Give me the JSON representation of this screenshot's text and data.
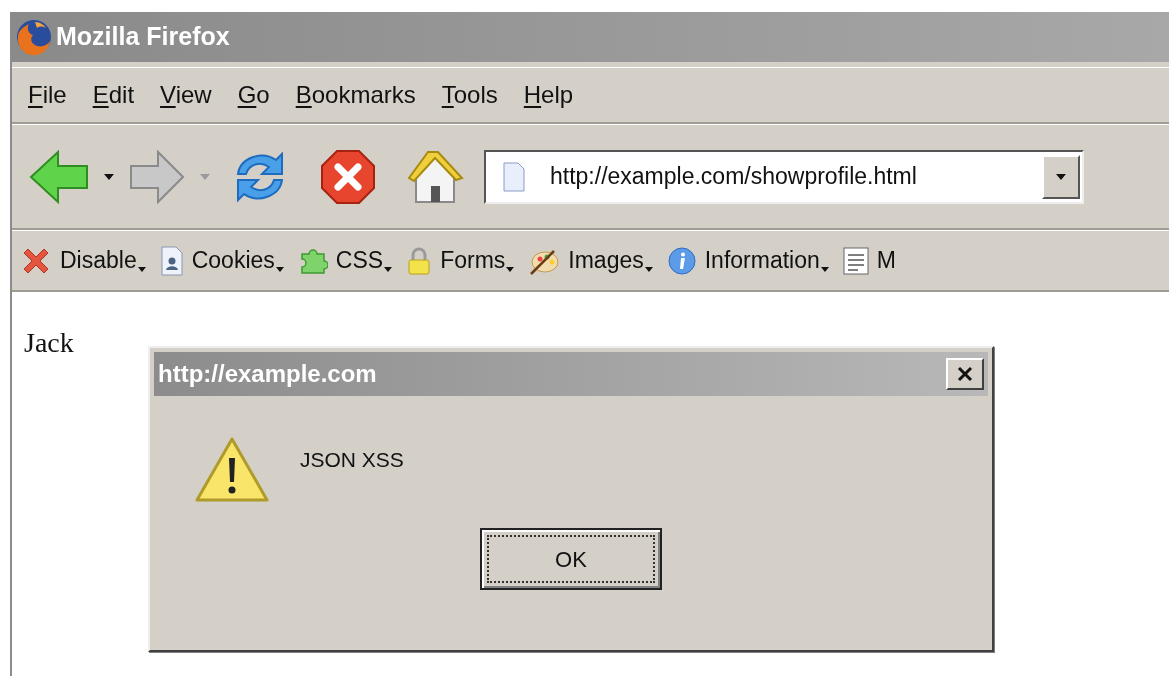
{
  "window": {
    "title": "Mozilla Firefox"
  },
  "menu": [
    {
      "label": "File",
      "access_key_underlined": true
    },
    {
      "label": "Edit",
      "access_key_underlined": true
    },
    {
      "label": "View",
      "access_key_underlined": true
    },
    {
      "label": "Go",
      "access_key_underlined": true
    },
    {
      "label": "Bookmarks",
      "access_key_underlined": true
    },
    {
      "label": "Tools",
      "access_key_underlined": true
    },
    {
      "label": "Help",
      "access_key_underlined": true
    }
  ],
  "navigation": {
    "back": {
      "disabled": false
    },
    "forward": {
      "disabled": true
    }
  },
  "address_bar": {
    "value": "http://example.com/showprofile.html"
  },
  "extension_toolbar": [
    {
      "kind": "disable",
      "label": "Disable"
    },
    {
      "kind": "cookies",
      "label": "Cookies"
    },
    {
      "kind": "css",
      "label": "CSS"
    },
    {
      "kind": "forms",
      "label": "Forms"
    },
    {
      "kind": "images",
      "label": "Images"
    },
    {
      "kind": "information",
      "label": "Information"
    },
    {
      "kind": "misc",
      "label": "M"
    }
  ],
  "page": {
    "text": "Jack"
  },
  "dialog": {
    "title": "http://example.com",
    "message": "JSON XSS",
    "buttons": [
      "OK"
    ]
  }
}
